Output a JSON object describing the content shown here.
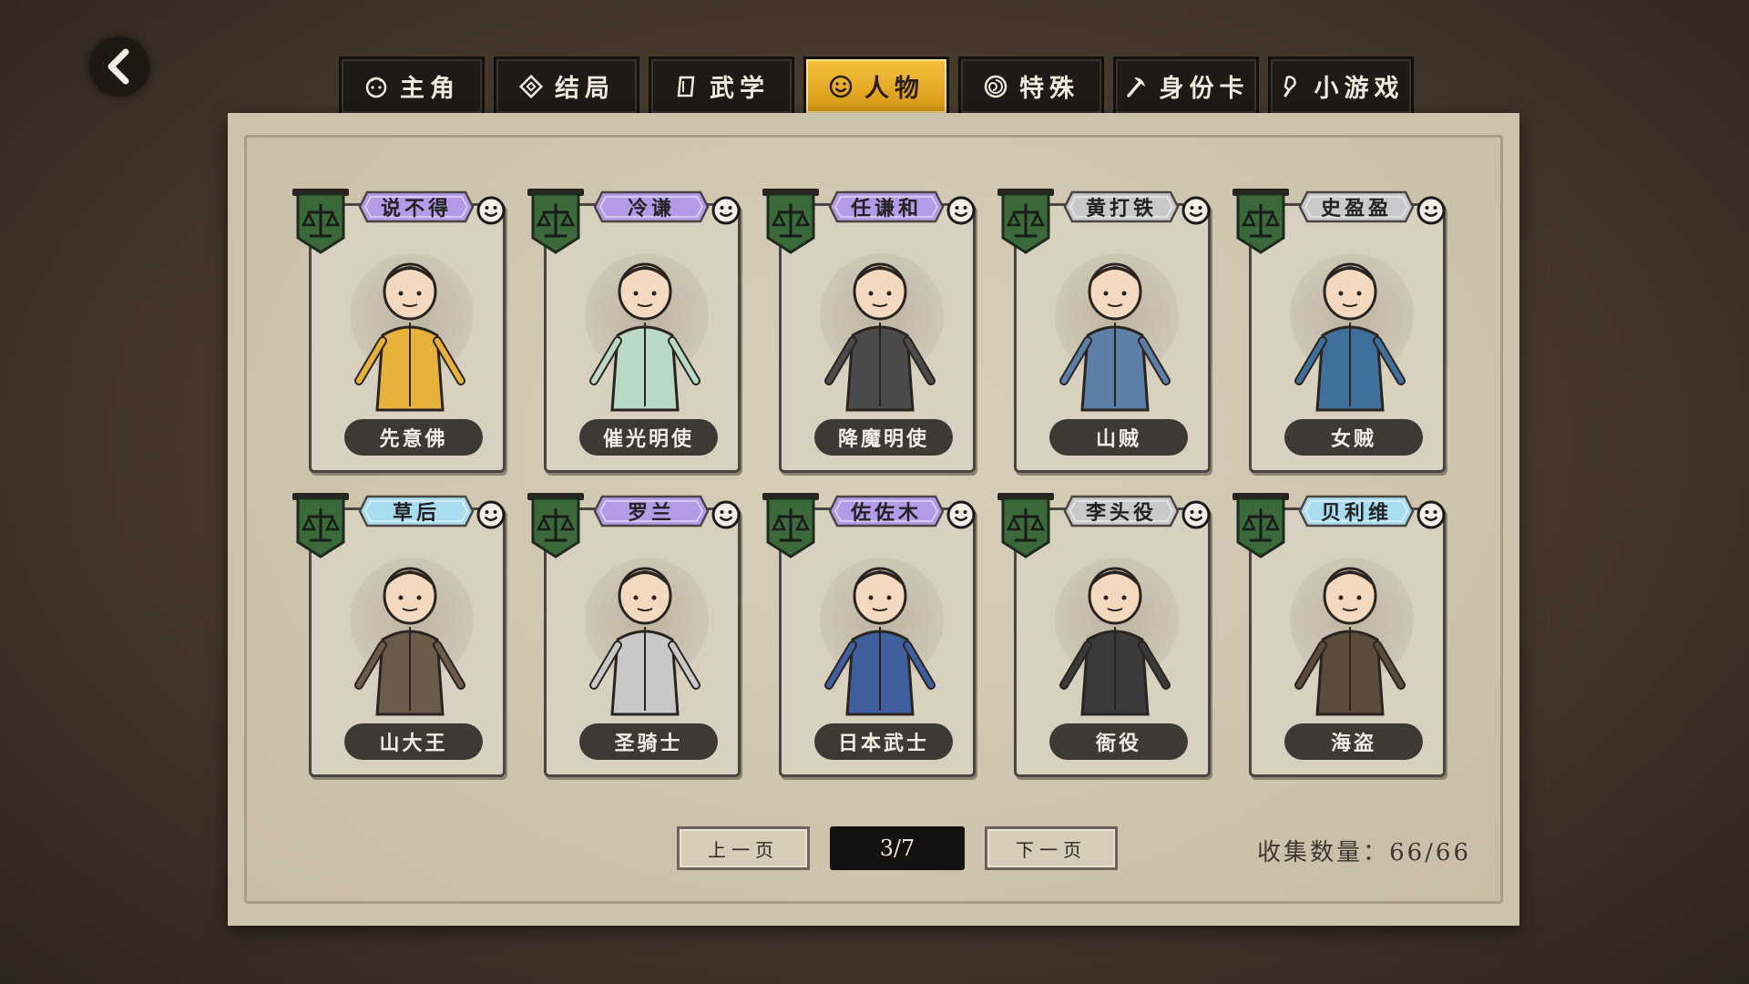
{
  "tabs": [
    {
      "label": "主角",
      "icon": "face-outline-icon"
    },
    {
      "label": "结局",
      "icon": "diamond-icon"
    },
    {
      "label": "武学",
      "icon": "book-icon"
    },
    {
      "label": "人物",
      "icon": "smiley-icon",
      "active": true
    },
    {
      "label": "特殊",
      "icon": "swirl-icon"
    },
    {
      "label": "身份卡",
      "icon": "pickaxe-icon"
    },
    {
      "label": "小游戏",
      "icon": "controller-icon"
    }
  ],
  "cards": [
    {
      "tag": "说不得",
      "name": "先意佛",
      "tag_color": "#b49be8"
    },
    {
      "tag": "冷谦",
      "name": "催光明使",
      "tag_color": "#b49be8"
    },
    {
      "tag": "任谦和",
      "name": "降魔明使",
      "tag_color": "#b49be8"
    },
    {
      "tag": "黄打铁",
      "name": "山贼",
      "tag_color": "#c9c9c9"
    },
    {
      "tag": "史盈盈",
      "name": "女贼",
      "tag_color": "#c9c9c9"
    },
    {
      "tag": "草后",
      "name": "山大王",
      "tag_color": "#a9dcee"
    },
    {
      "tag": "罗兰",
      "name": "圣骑士",
      "tag_color": "#b49be8"
    },
    {
      "tag": "佐佐木",
      "name": "日本武士",
      "tag_color": "#b49be8"
    },
    {
      "tag": "李头役",
      "name": "衙役",
      "tag_color": "#c9c9c9"
    },
    {
      "tag": "贝利维",
      "name": "海盗",
      "tag_color": "#a9dcee"
    }
  ],
  "pager": {
    "prev": "上一页",
    "indicator": "3/7",
    "next": "下一页"
  },
  "collection": {
    "label": "收集数量：",
    "value": "66/66"
  },
  "colors": {
    "active_tab": "#f0b62e",
    "banner_green": "#3b6a3a",
    "panel": "#cdc3ad"
  }
}
